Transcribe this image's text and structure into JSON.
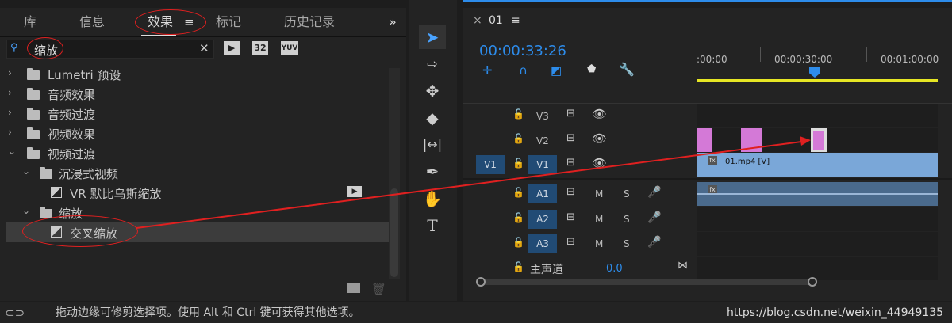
{
  "effects_panel": {
    "tabs": [
      "库",
      "信息",
      "效果",
      "标记",
      "历史记录"
    ],
    "active_tab": "效果",
    "search": {
      "value": "缩放"
    },
    "filter_buttons": [
      "32",
      "YUV"
    ],
    "tree": [
      {
        "label": "Lumetri 预设"
      },
      {
        "label": "音频效果"
      },
      {
        "label": "音频过渡"
      },
      {
        "label": "视频效果"
      },
      {
        "label": "视频过渡"
      },
      {
        "label": "沉浸式视频"
      },
      {
        "label": "VR 默比乌斯缩放"
      },
      {
        "label": "缩放"
      },
      {
        "label": "交叉缩放"
      }
    ]
  },
  "timeline": {
    "sequence_name": "01",
    "timecode": "00:00:33:26",
    "ruler": [
      ":00:00",
      "00:00:30:00",
      "00:01:00:00"
    ],
    "tracks_video": [
      "V3",
      "V2",
      "V1"
    ],
    "tracks_audio": [
      "A1",
      "A2",
      "A3"
    ],
    "source_patch_v": "V1",
    "mix_label": "主声道",
    "mix_value": "0.0",
    "clip_v1_label": "01.mp4 [V]",
    "mute": "M",
    "solo": "S"
  },
  "status_bar": {
    "text": "拖动边缘可修剪选择项。使用 Alt 和 Ctrl 键可获得其他选项。",
    "watermark": "https://blog.csdn.net/weixin_44949135"
  },
  "colors": {
    "accent_blue": "#2d8ceb",
    "clip_pink": "#d479d7",
    "clip_blue": "#7aa7d8",
    "work_area": "#e6e624",
    "annotation_red": "#e02020"
  }
}
